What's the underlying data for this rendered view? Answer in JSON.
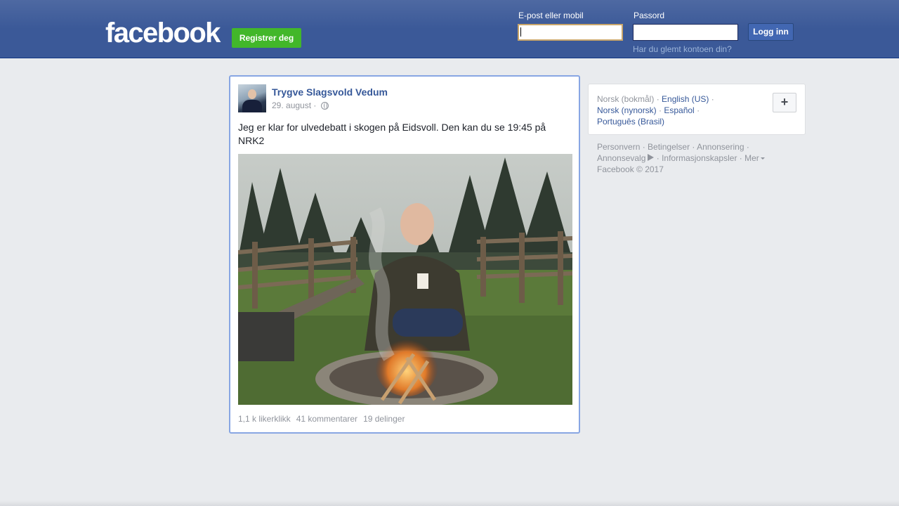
{
  "header": {
    "logo": "facebook",
    "register_label": "Registrer deg",
    "email_label": "E-post eller mobil",
    "password_label": "Passord",
    "email_value": "",
    "password_value": "",
    "login_label": "Logg inn",
    "forgot_label": "Har du glemt kontoen din?"
  },
  "post": {
    "author": "Trygve Slagsvold Vedum",
    "date": "29. august ·",
    "privacy_icon": "globe-icon",
    "text": "Jeg er klar for ulvedebatt i skogen på Eidsvoll. Den kan du se 19:45 på NRK2",
    "stats": {
      "likes": "1,1 k likerklikk",
      "comments": "41 kommentarer",
      "shares": "19 delinger"
    }
  },
  "languages": {
    "current": "Norsk (bokmål)",
    "options": [
      "English (US)",
      "Norsk (nynorsk)",
      "Español",
      "Português (Brasil)"
    ],
    "more_icon": "plus-icon"
  },
  "footer": {
    "links": [
      "Personvern",
      "Betingelser",
      "Annonsering",
      "Annonsevalg",
      "Informasjonskapsler",
      "Mer"
    ],
    "copyright": "Facebook © 2017"
  },
  "colors": {
    "header_blue": "#3b5998",
    "link_blue": "#365899",
    "register_green": "#42b72a",
    "page_bg": "#e9ebee"
  }
}
